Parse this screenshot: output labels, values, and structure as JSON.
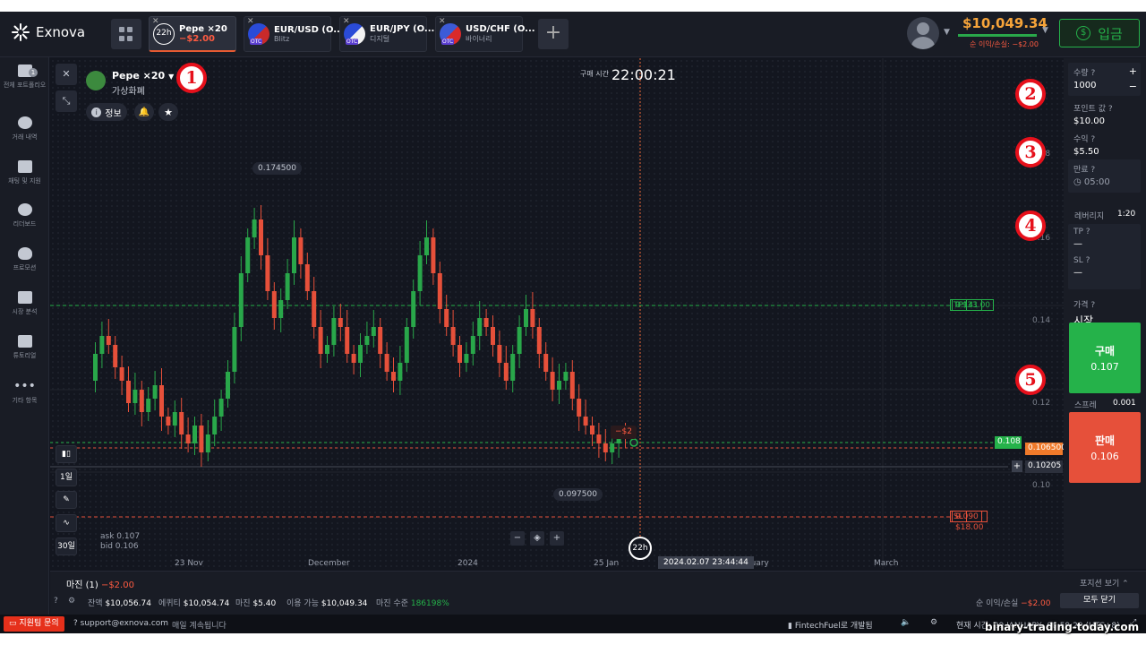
{
  "app": {
    "brand": "Exnova"
  },
  "tabs": [
    {
      "name": "Pepe ×20",
      "sub": "−$2.00",
      "badge": "22h",
      "active": true
    },
    {
      "name": "EUR/USD (O...",
      "sub": "Blitz",
      "badge": "OTC"
    },
    {
      "name": "EUR/JPY (O...",
      "sub": "디지털",
      "badge": "OTC"
    },
    {
      "name": "USD/CHF (O...",
      "sub": "바이너리",
      "badge": "OTC"
    }
  ],
  "account": {
    "balance": "$10,049.34",
    "pnl": "순 이익/손실: −$2.00",
    "deposit": "입금"
  },
  "sidebar": [
    {
      "label": "전체 포트폴리오",
      "icon": "portfolio-icon",
      "badge": "1"
    },
    {
      "label": "거래 내역",
      "icon": "history-icon"
    },
    {
      "label": "채팅 및 지원",
      "icon": "chat-icon"
    },
    {
      "label": "리더보드",
      "icon": "leaderboard-icon"
    },
    {
      "label": "프로모션",
      "icon": "fire-icon"
    },
    {
      "label": "시장 분석",
      "icon": "analysis-icon"
    },
    {
      "label": "튜토리얼",
      "icon": "tutorial-icon"
    },
    {
      "label": "기타 항목",
      "icon": "more-icon"
    }
  ],
  "asset": {
    "name": "Pepe ×20",
    "sub": "가상화폐",
    "info": "정보"
  },
  "chart": {
    "timer_label": "구매 시간",
    "timer": "22:00:21",
    "high": "0.174500",
    "low": "0.097500",
    "tp": {
      "label": "TP",
      "amount": "+$33.00",
      "price": "0.141"
    },
    "sl": {
      "label": "SL",
      "amount": "−$18.00",
      "price": "0.090"
    },
    "current_buy": "0.108",
    "current_sell": "0.106500",
    "cursor_price": "0.10205",
    "trade_bubble": "−$2",
    "y_ticks": [
      "0.18",
      "0.16",
      "0.14",
      "0.12",
      "0.10"
    ],
    "x_labels": [
      "23 Nov",
      "December",
      "2024",
      "25 Jan",
      "February",
      "March"
    ],
    "cursor_time": "2024.02.07 23:44:44",
    "expiry_badge": "22h",
    "ask": "ask 0.107",
    "bid": "bid 0.106",
    "tools": [
      "1일",
      "30일"
    ]
  },
  "annotations": [
    "1",
    "2",
    "3",
    "4",
    "5"
  ],
  "panel": {
    "qty_label": "수량",
    "qty": "1000",
    "point_label": "포인트 값",
    "point": "$10.00",
    "profit_label": "수익",
    "profit": "$5.50",
    "expiry_label": "만료",
    "expiry": "05:00",
    "lev_label": "레버리지",
    "lev": "1:20",
    "tp_label": "TP",
    "tp": "—",
    "sl_label": "SL",
    "sl": "—",
    "price_label": "가격",
    "price": "시장",
    "buy_label": "구매",
    "buy_price": "0.107",
    "spread_label": "스프레",
    "spread": "0.001",
    "sell_label": "판매",
    "sell_price": "0.106"
  },
  "bottom": {
    "margin_tab": "마진 (1)",
    "margin_pnl": "−$2.00",
    "positions": "포지션 보기",
    "balance_label": "잔액",
    "balance": "$10,056.74",
    "equity_label": "에퀴티",
    "equity": "$10,054.74",
    "margin_label": "마진",
    "margin": "$5.40",
    "avail_label": "이용 가능",
    "avail": "$10,049.34",
    "level_label": "마진 수준",
    "level": "186198%",
    "net_label": "순 이익/손실",
    "net": "−$2.00",
    "close_all": "모두 닫기"
  },
  "status": {
    "support": "지원팀 문의",
    "email": "support@exnova.com",
    "daily": "매일 계속됩니다",
    "dev": "FintechFuel로 개발됨",
    "time": "현재 시간: 29 JANUARY, 06:59:20 (UTC+8)",
    "watermark": "binary-trading-today.com"
  },
  "colors": {
    "accent_orange": "#f7a43a",
    "buy": "#25b24a",
    "sell": "#e6503a",
    "up_candle": "#29a74a",
    "down_candle": "#e6503a"
  }
}
